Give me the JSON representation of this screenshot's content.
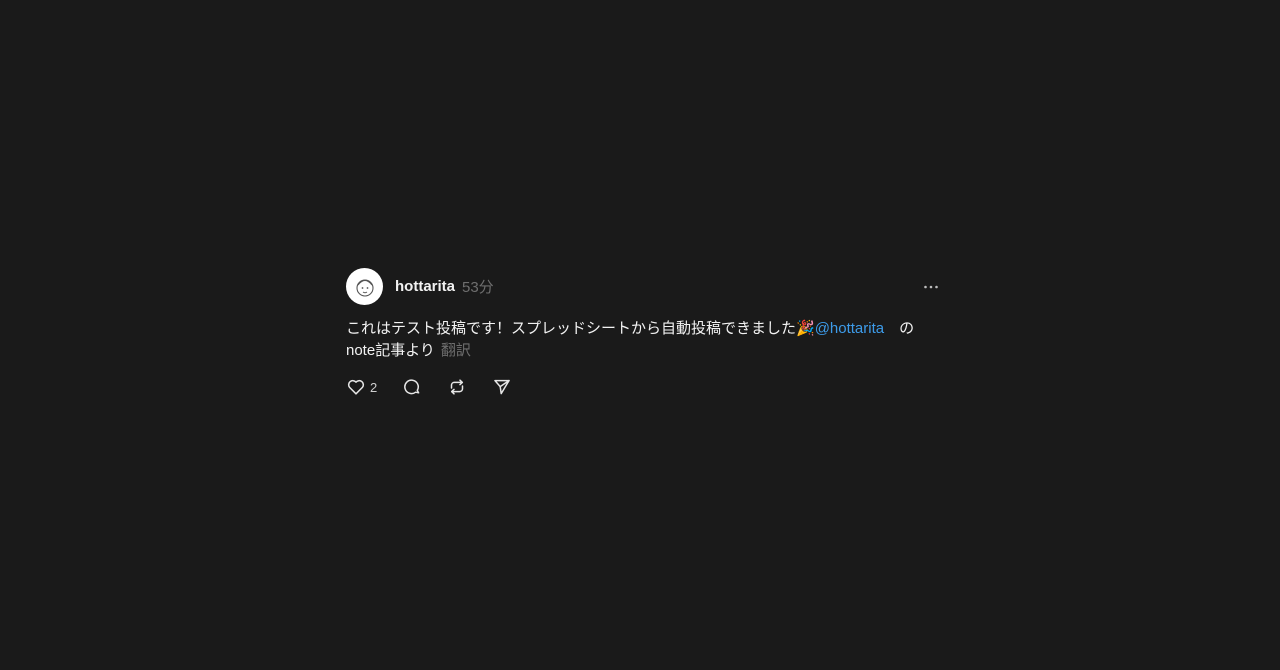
{
  "post": {
    "username": "hottarita",
    "timestamp": "53分",
    "text_before": "これはテスト投稿です！スプレッドシートから自動投稿できました🎉",
    "mention": "@hottarita",
    "text_after": "　の note記事より",
    "translate_label": "翻訳",
    "like_count": "2"
  },
  "icons": {
    "avatar": "avatar-illustration",
    "more": "more-horizontal-icon",
    "like": "heart-icon",
    "reply": "comment-bubble-icon",
    "repost": "repost-icon",
    "share": "send-icon"
  },
  "colors": {
    "background": "#1a1a1a",
    "text": "#f2f2f2",
    "muted": "#6e6e6e",
    "link": "#3d9be9"
  }
}
